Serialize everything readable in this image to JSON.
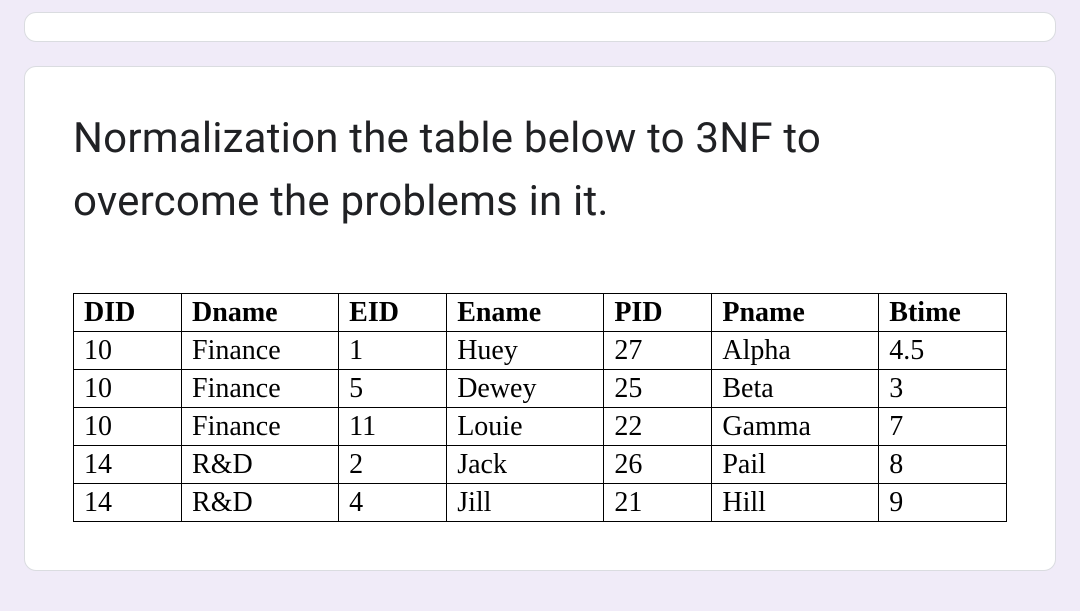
{
  "question": "Normalization the table below to 3NF to overcome the problems in it.",
  "table": {
    "headers": [
      "DID",
      "Dname",
      "EID",
      "Ename",
      "PID",
      "Pname",
      "Btime"
    ],
    "rows": [
      [
        "10",
        "Finance",
        "1",
        "Huey",
        "27",
        "Alpha",
        "4.5"
      ],
      [
        "10",
        "Finance",
        "5",
        "Dewey",
        "25",
        "Beta",
        "3"
      ],
      [
        "10",
        "Finance",
        "11",
        "Louie",
        "22",
        "Gamma",
        "7"
      ],
      [
        "14",
        "R&D",
        "2",
        "Jack",
        "26",
        "Pail",
        "8"
      ],
      [
        "14",
        "R&D",
        "4",
        "Jill",
        "21",
        "Hill",
        "9"
      ]
    ]
  }
}
